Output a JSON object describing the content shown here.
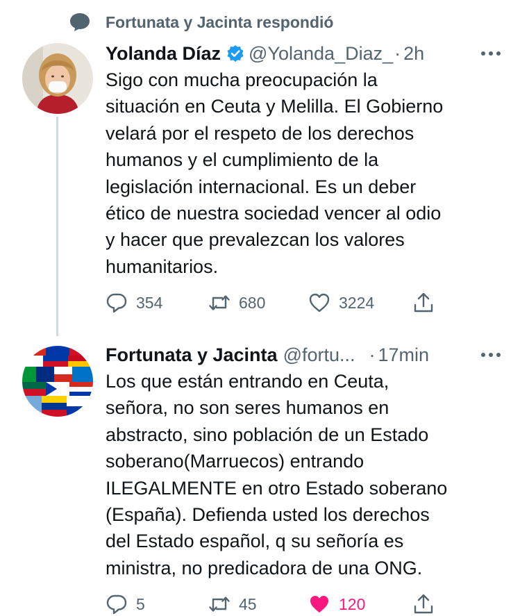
{
  "context": {
    "text": "Fortunata y Jacinta respondió",
    "icon": "speech-bubble-icon"
  },
  "tweets": [
    {
      "name": "Yolanda Díaz",
      "verified": true,
      "handle": "@Yolanda_Diaz_",
      "separator": "·",
      "time": "2h",
      "lines": [
        "Sigo con mucha preocupación la",
        "situación en Ceuta y Melilla. El Gobierno",
        "velará por el respeto de los derechos",
        "humanos y el cumplimiento de la",
        "legislación internacional. Es un deber",
        "ético de nuestra sociedad vencer al odio",
        "y hacer que prevalezcan los valores",
        "humanitarios."
      ],
      "replies": "354",
      "retweets": "680",
      "likes": "3224",
      "liked": false
    },
    {
      "name": "Fortunata y Jacinta",
      "verified": false,
      "handle": "@fortu...",
      "separator": "·",
      "time": "17min",
      "lines": [
        "Los que están entrando en Ceuta,",
        "señora, no son seres humanos en",
        "abstracto, sino población de un Estado",
        "soberano(Marruecos) entrando",
        "ILEGALMENTE en otro Estado soberano",
        "(España). Defienda usted los derechos",
        "del Estado español, q su señoría es",
        "ministra, no predicadora de una ONG."
      ],
      "replies": "5",
      "retweets": "45",
      "likes": "120",
      "liked": true
    }
  ],
  "colors": {
    "accent": "#1d9bf0",
    "like": "#f91880",
    "muted": "#536471",
    "text": "#0f1419"
  }
}
